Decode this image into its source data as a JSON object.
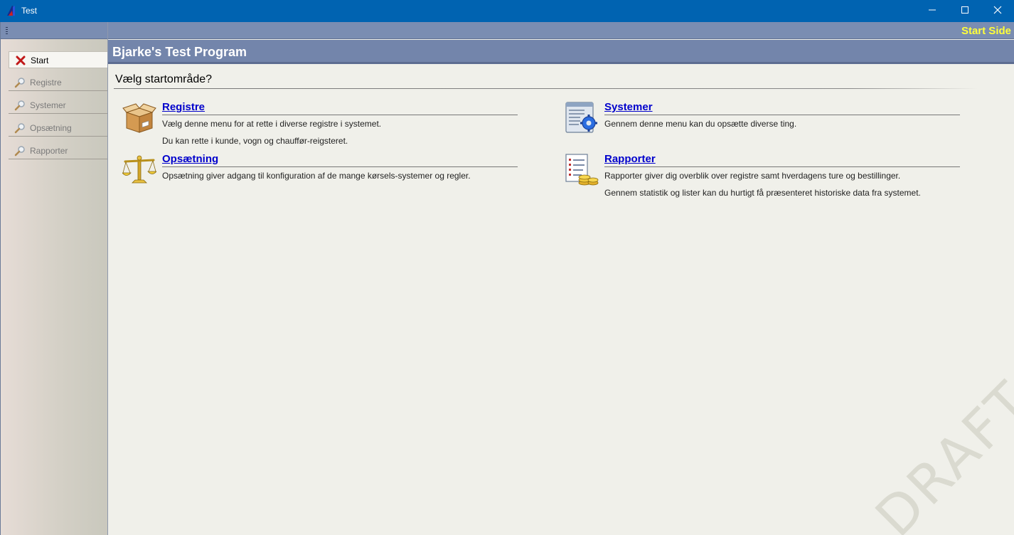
{
  "window": {
    "title": "Test",
    "min_icon": "minimize-icon",
    "max_icon": "maximize-icon",
    "close_icon": "close-icon"
  },
  "sidebar": {
    "items": [
      {
        "label": "Start",
        "icon": "close-x-icon",
        "active": true
      },
      {
        "label": "Registre",
        "icon": "magnifier-icon",
        "active": false
      },
      {
        "label": "Systemer",
        "icon": "magnifier-icon",
        "active": false
      },
      {
        "label": "Opsætning",
        "icon": "magnifier-icon",
        "active": false
      },
      {
        "label": "Rapporter",
        "icon": "magnifier-icon",
        "active": false
      }
    ]
  },
  "header": {
    "breadcrumb": "Start Side",
    "app_title": "Bjarke's Test Program"
  },
  "main": {
    "heading": "Vælg startområde?",
    "entries": [
      {
        "title": "Registre",
        "icon": "box-icon",
        "lines": [
          "Vælg denne menu for at rette i diverse registre i systemet.",
          "Du kan rette i kunde, vogn og chauffør-reigsteret."
        ]
      },
      {
        "title": "Systemer",
        "icon": "settings-window-icon",
        "lines": [
          "Gennem denne menu kan du opsætte diverse ting."
        ]
      },
      {
        "title": "Opsætning",
        "icon": "scales-icon",
        "lines": [
          "Opsætning giver adgang til konfiguration af de mange kørsels-systemer og regler."
        ]
      },
      {
        "title": "Rapporter",
        "icon": "report-coins-icon",
        "lines": [
          "Rapporter giver dig overblik over registre samt hverdagens ture og bestillinger.",
          "Gennem statistik og lister kan du hurtigt få præsenteret historiske data fra systemet."
        ]
      }
    ]
  },
  "watermark": "DRAFT",
  "colors": {
    "titlebar": "#0063b1",
    "banner": "#7385ab",
    "breadcrumb": "#ffff3a",
    "link": "#0000cc"
  }
}
